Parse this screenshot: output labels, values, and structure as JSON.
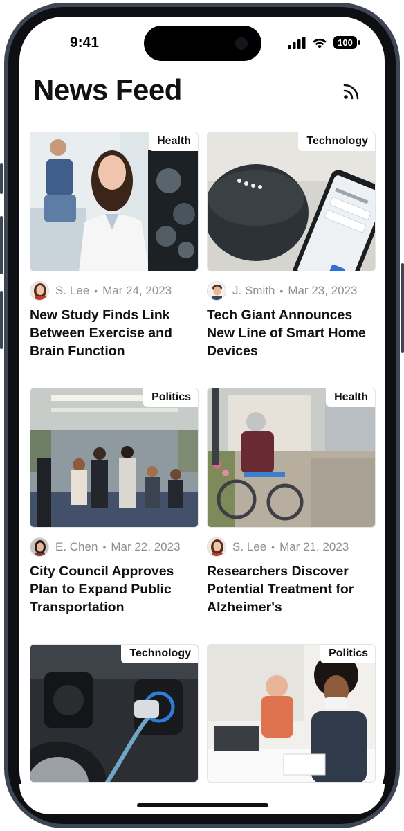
{
  "status_bar": {
    "time": "9:41",
    "battery": "100"
  },
  "header": {
    "title": "News Feed",
    "icon": "rss-icon"
  },
  "articles": [
    {
      "category": "Health",
      "author": "S. Lee",
      "date": "Mar 24, 2023",
      "headline": "New Study Finds Link Between Exercise and Brain Function"
    },
    {
      "category": "Technology",
      "author": "J. Smith",
      "date": "Mar 23, 2023",
      "headline": "Tech Giant Announces New Line of Smart Home Devices"
    },
    {
      "category": "Politics",
      "author": "E. Chen",
      "date": "Mar 22, 2023",
      "headline": "City Council Approves Plan to Expand Public Transportation"
    },
    {
      "category": "Health",
      "author": "S. Lee",
      "date": "Mar 21, 2023",
      "headline": "Researchers Discover Potential Treatment for Alzheimer's"
    },
    {
      "category": "Technology"
    },
    {
      "category": "Politics"
    }
  ],
  "separator": "•",
  "colors": {
    "text": "#111111",
    "meta": "#8e8e93",
    "frame": "#3e4654"
  }
}
